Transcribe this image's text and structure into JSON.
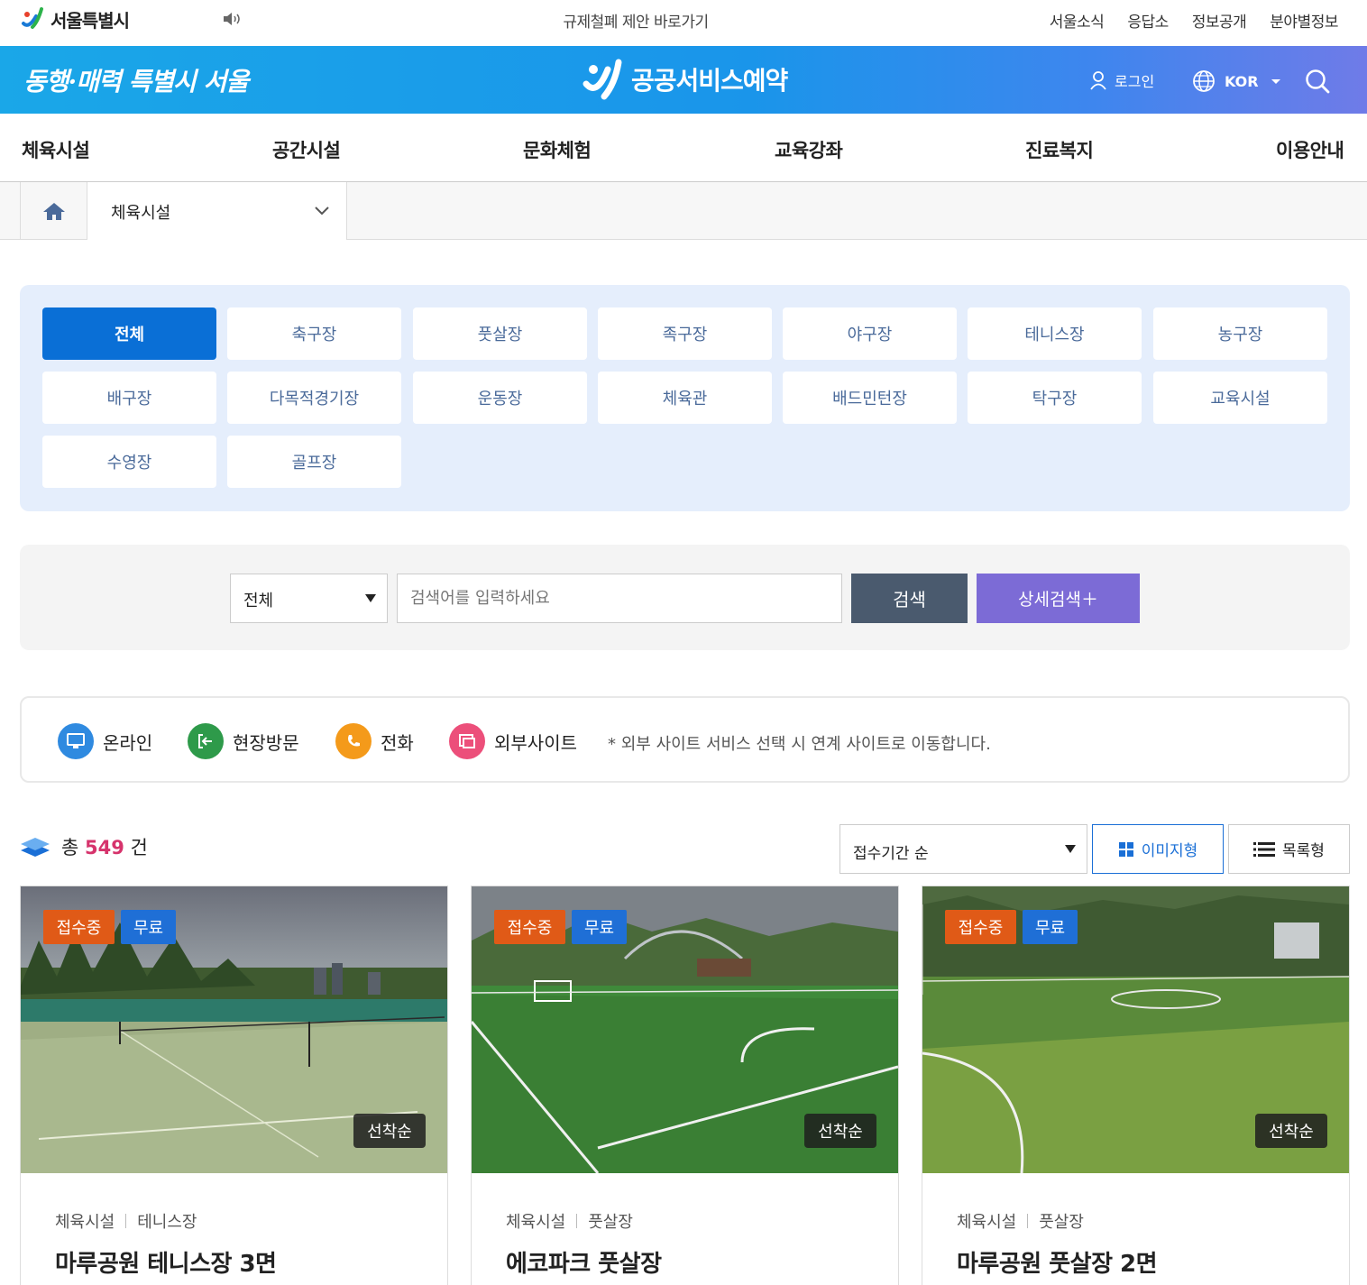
{
  "top": {
    "logo_name": "서울특별시",
    "center_link": "규제철폐 제안 바로가기",
    "links": [
      "서울소식",
      "응답소",
      "정보공개",
      "분야별정보"
    ]
  },
  "header": {
    "slogan": "동행·매력 특별시 서울",
    "brand": "공공서비스예약",
    "login": "로그인",
    "lang": "KOR"
  },
  "nav": [
    "체육시설",
    "공간시설",
    "문화체험",
    "교육강좌",
    "진료복지",
    "이용안내"
  ],
  "breadcrumb": {
    "current": "체육시설"
  },
  "categories": [
    "전체",
    "축구장",
    "풋살장",
    "족구장",
    "야구장",
    "테니스장",
    "농구장",
    "배구장",
    "다목적경기장",
    "운동장",
    "체육관",
    "배드민턴장",
    "탁구장",
    "교육시설",
    "수영장",
    "골프장"
  ],
  "search": {
    "scope": "전체",
    "placeholder": "검색어를 입력하세요",
    "search_label": "검색",
    "detail_label": "상세검색＋"
  },
  "legend": {
    "online": "온라인",
    "visit": "현장방문",
    "phone": "전화",
    "external": "외부사이트",
    "note": "* 외부 사이트 서비스 선택 시 연계 사이트로 이동합니다."
  },
  "results": {
    "prefix": "총",
    "count": "549",
    "suffix": "건",
    "sort": "접수기간 순",
    "view_image": "이미지형",
    "view_list": "목록형"
  },
  "cards": [
    {
      "status": "접수중",
      "fee": "무료",
      "method": "선착순",
      "cat1": "체육시설",
      "cat2": "테니스장",
      "title": "마루공원 테니스장 3면"
    },
    {
      "status": "접수중",
      "fee": "무료",
      "method": "선착순",
      "cat1": "체육시설",
      "cat2": "풋살장",
      "title": "에코파크 풋살장"
    },
    {
      "status": "접수중",
      "fee": "무료",
      "method": "선착순",
      "cat1": "체육시설",
      "cat2": "풋살장",
      "title": "마루공원 풋살장 2면"
    }
  ],
  "colors": {
    "primary": "#0a6fd6",
    "accent_count": "#d6336c",
    "status_badge": "#e05a17",
    "fee_badge": "#1f6fd6"
  }
}
